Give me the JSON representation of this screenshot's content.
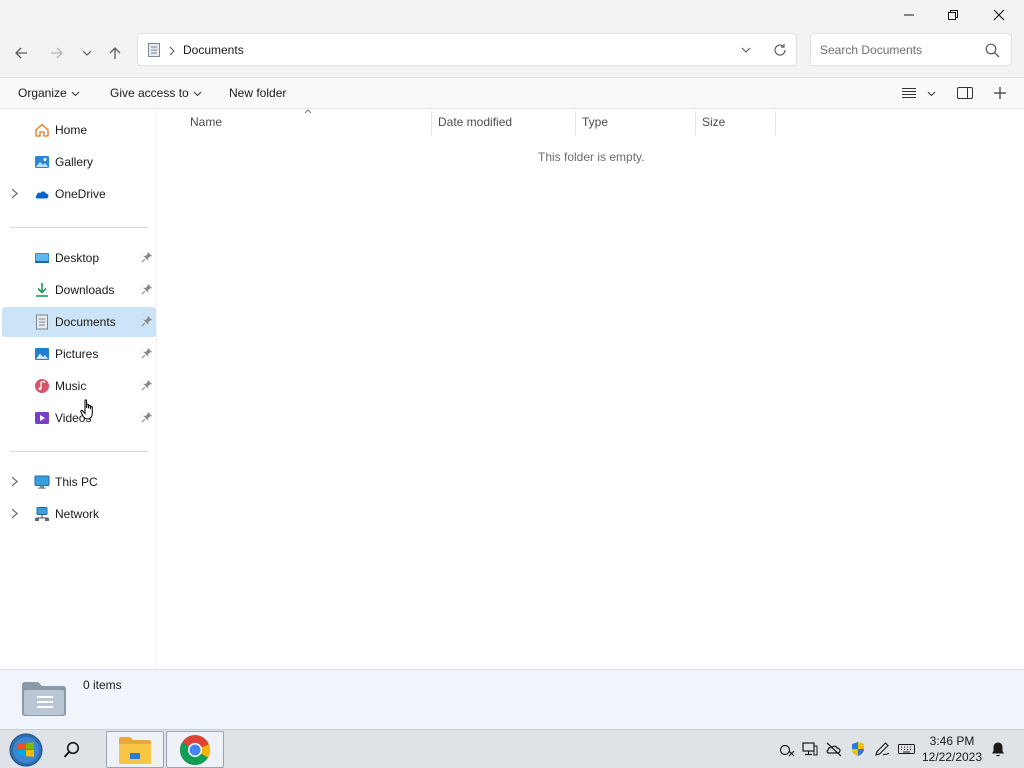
{
  "window": {
    "minimize_icon": "minimize-icon",
    "maximize_icon": "restore-icon",
    "close_icon": "close-icon"
  },
  "address_bar": {
    "location_icon": "documents-folder-icon",
    "path": [
      "Documents"
    ],
    "current": "Documents"
  },
  "search": {
    "placeholder": "Search Documents"
  },
  "command_bar": {
    "organize": "Organize",
    "give_access": "Give access to",
    "new_folder": "New folder"
  },
  "sidebar": {
    "top": [
      {
        "label": "Home",
        "icon": "home-icon"
      },
      {
        "label": "Gallery",
        "icon": "gallery-icon"
      },
      {
        "label": "OneDrive",
        "icon": "onedrive-icon"
      }
    ],
    "pinned": [
      {
        "label": "Desktop",
        "icon": "desktop-icon"
      },
      {
        "label": "Downloads",
        "icon": "downloads-icon"
      },
      {
        "label": "Documents",
        "icon": "documents-icon",
        "selected": true
      },
      {
        "label": "Pictures",
        "icon": "pictures-icon"
      },
      {
        "label": "Music",
        "icon": "music-icon"
      },
      {
        "label": "Videos",
        "icon": "videos-icon"
      }
    ],
    "bottom": [
      {
        "label": "This PC",
        "icon": "this-pc-icon"
      },
      {
        "label": "Network",
        "icon": "network-icon"
      }
    ]
  },
  "columns": {
    "name": "Name",
    "date_modified": "Date modified",
    "type": "Type",
    "size": "Size"
  },
  "content": {
    "empty_message": "This folder is empty."
  },
  "details": {
    "items": "0 items"
  },
  "taskbar": {
    "time": "3:46 PM",
    "date": "12/22/2023"
  },
  "colors": {
    "selected_bg": "#cce4f7",
    "accent": "#0067c0"
  }
}
